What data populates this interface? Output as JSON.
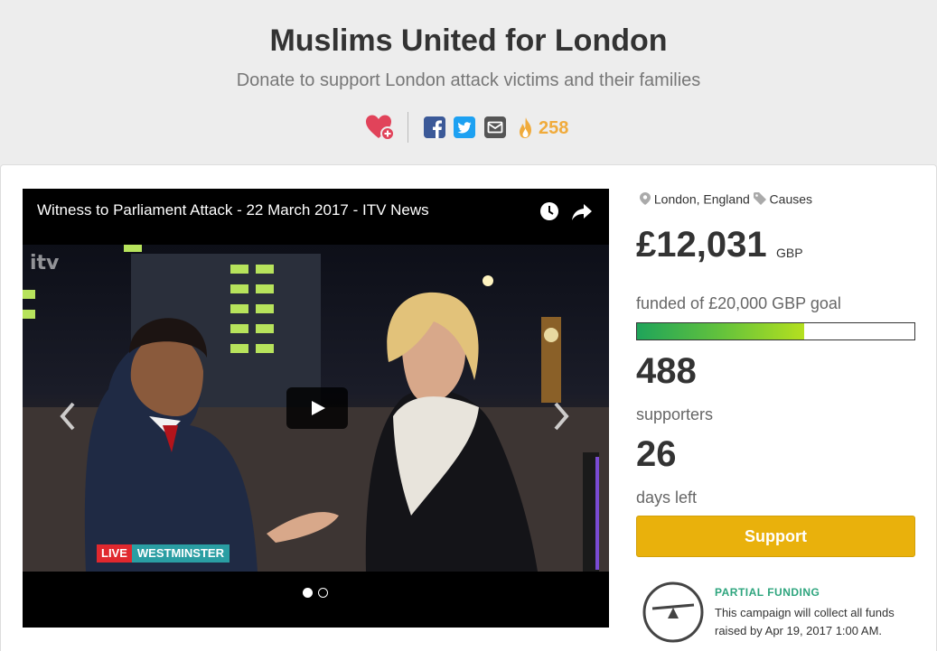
{
  "header": {
    "title": "Muslims United for London",
    "subtitle": "Donate to support London attack victims and their families",
    "fire_count": "258"
  },
  "video": {
    "title": "Witness to Parliament Attack - 22 March 2017 - ITV News",
    "logo_text": "itv",
    "live_label": "LIVE",
    "location_label": "WESTMINSTER",
    "slides": 2,
    "active_slide": 1
  },
  "campaign": {
    "location": "London, England",
    "category": "Causes",
    "amount": "£12,031",
    "currency": "GBP",
    "goal_text": "funded of £20,000 GBP goal",
    "progress_fraction": 0.60155,
    "supporters_count": "488",
    "supporters_label": "supporters",
    "days_count": "26",
    "days_label": "days left",
    "support_button": "Support",
    "partial_funding_title": "PARTIAL FUNDING",
    "partial_funding_text": "This campaign will collect all funds raised by Apr 19, 2017 1:00 AM."
  },
  "colors": {
    "accent": "#e9b10c",
    "heart": "#e1435a",
    "fire": "#f0ab3c",
    "partial_funding": "#2ea57e",
    "facebook": "#3b5998",
    "twitter": "#1da1f2"
  },
  "icons": [
    "heart-plus-icon",
    "facebook-icon",
    "twitter-icon",
    "mail-icon",
    "fire-icon",
    "clock-icon",
    "share-icon",
    "play-icon",
    "chevron-left-icon",
    "chevron-right-icon",
    "map-pin-icon",
    "tag-icon",
    "scale-icon"
  ]
}
